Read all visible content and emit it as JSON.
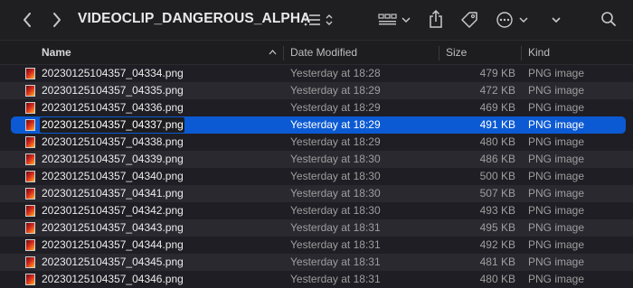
{
  "toolbar": {
    "title": "VIDEOCLIP_DANGEROUS_ALPHA",
    "icons": [
      "chevron-left-icon",
      "chevron-right-icon",
      "list-view-icon",
      "group-grid-icon",
      "share-icon",
      "tag-icon",
      "more-icon",
      "search-icon"
    ]
  },
  "columns": {
    "name": "Name",
    "date": "Date Modified",
    "size": "Size",
    "kind": "Kind"
  },
  "files": [
    {
      "name": "20230125104357_04334.png",
      "date": "Yesterday at 18:28",
      "size": "479 KB",
      "kind": "PNG image"
    },
    {
      "name": "20230125104357_04335.png",
      "date": "Yesterday at 18:29",
      "size": "472 KB",
      "kind": "PNG image"
    },
    {
      "name": "20230125104357_04336.png",
      "date": "Yesterday at 18:29",
      "size": "469 KB",
      "kind": "PNG image"
    },
    {
      "name": "20230125104357_04337.png",
      "date": "Yesterday at 18:29",
      "size": "491 KB",
      "kind": "PNG image",
      "selected": true
    },
    {
      "name": "20230125104357_04338.png",
      "date": "Yesterday at 18:29",
      "size": "480 KB",
      "kind": "PNG image"
    },
    {
      "name": "20230125104357_04339.png",
      "date": "Yesterday at 18:30",
      "size": "486 KB",
      "kind": "PNG image"
    },
    {
      "name": "20230125104357_04340.png",
      "date": "Yesterday at 18:30",
      "size": "500 KB",
      "kind": "PNG image"
    },
    {
      "name": "20230125104357_04341.png",
      "date": "Yesterday at 18:30",
      "size": "507 KB",
      "kind": "PNG image"
    },
    {
      "name": "20230125104357_04342.png",
      "date": "Yesterday at 18:30",
      "size": "493 KB",
      "kind": "PNG image"
    },
    {
      "name": "20230125104357_04343.png",
      "date": "Yesterday at 18:31",
      "size": "495 KB",
      "kind": "PNG image"
    },
    {
      "name": "20230125104357_04344.png",
      "date": "Yesterday at 18:31",
      "size": "492 KB",
      "kind": "PNG image"
    },
    {
      "name": "20230125104357_04345.png",
      "date": "Yesterday at 18:31",
      "size": "481 KB",
      "kind": "PNG image"
    },
    {
      "name": "20230125104357_04346.png",
      "date": "Yesterday at 18:31",
      "size": "480 KB",
      "kind": "PNG image"
    }
  ]
}
